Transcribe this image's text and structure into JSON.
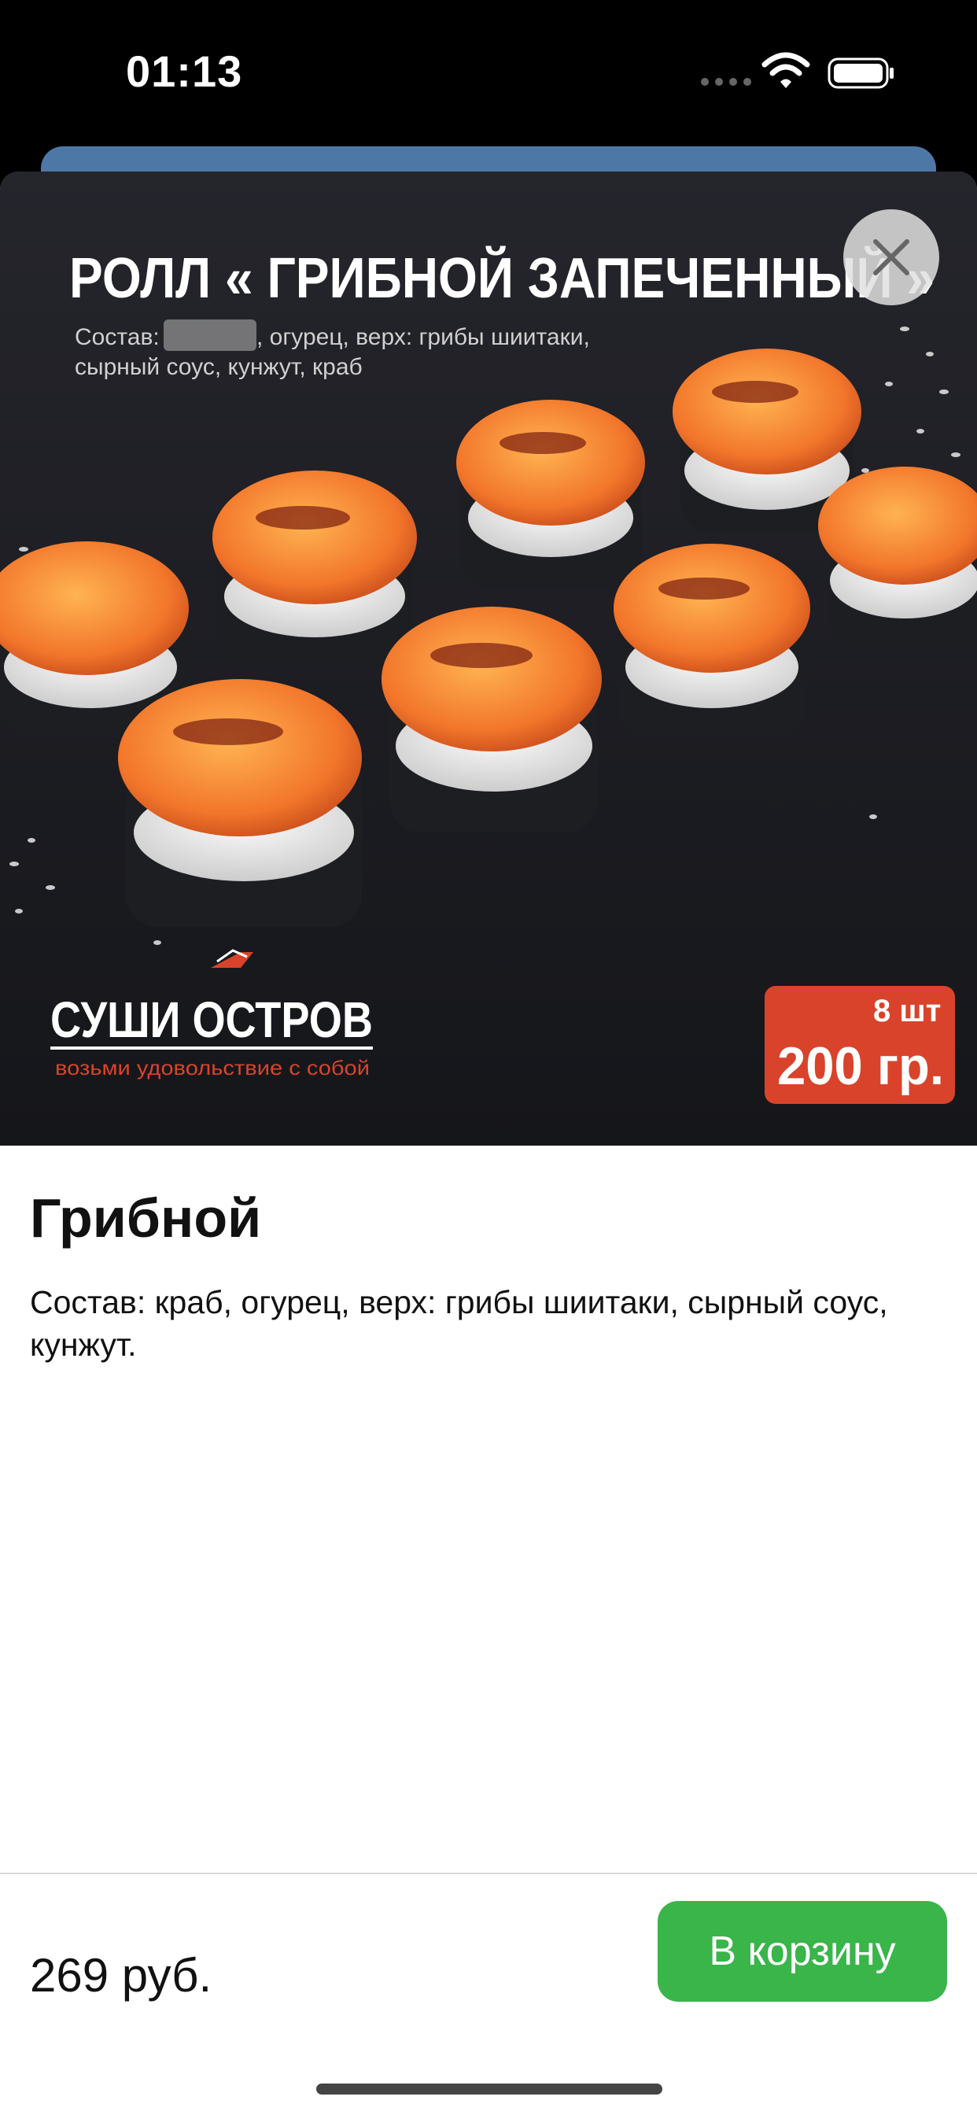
{
  "status_bar": {
    "time": "01:13"
  },
  "hero": {
    "headline": "РОЛЛ « ГРИБНОЙ ЗАПЕЧЕННЫЙ »",
    "ingredients_line1_prefix": "Состав:",
    "ingredients_line1_suffix": ", огурец, верх: грибы шиитаки,",
    "ingredients_line2": "сырный соус, кунжут, краб",
    "brand_name": "СУШИ ОСТРОВ",
    "brand_tagline": "возьми удовольствие с собой",
    "pieces": "8 шт",
    "weight": "200 гр.",
    "badge_color": "#d9432b"
  },
  "product": {
    "title": "Грибной",
    "description": "Состав: краб, огурец, верх: грибы шиитаки, сырный соус, кунжут."
  },
  "footer": {
    "price": "269 руб.",
    "cart_button_label": "В корзину",
    "accent_color": "#39b54a"
  },
  "icons": {
    "close": "close-icon",
    "wifi": "wifi-icon",
    "battery": "battery-icon",
    "signal": "signal-icon"
  }
}
